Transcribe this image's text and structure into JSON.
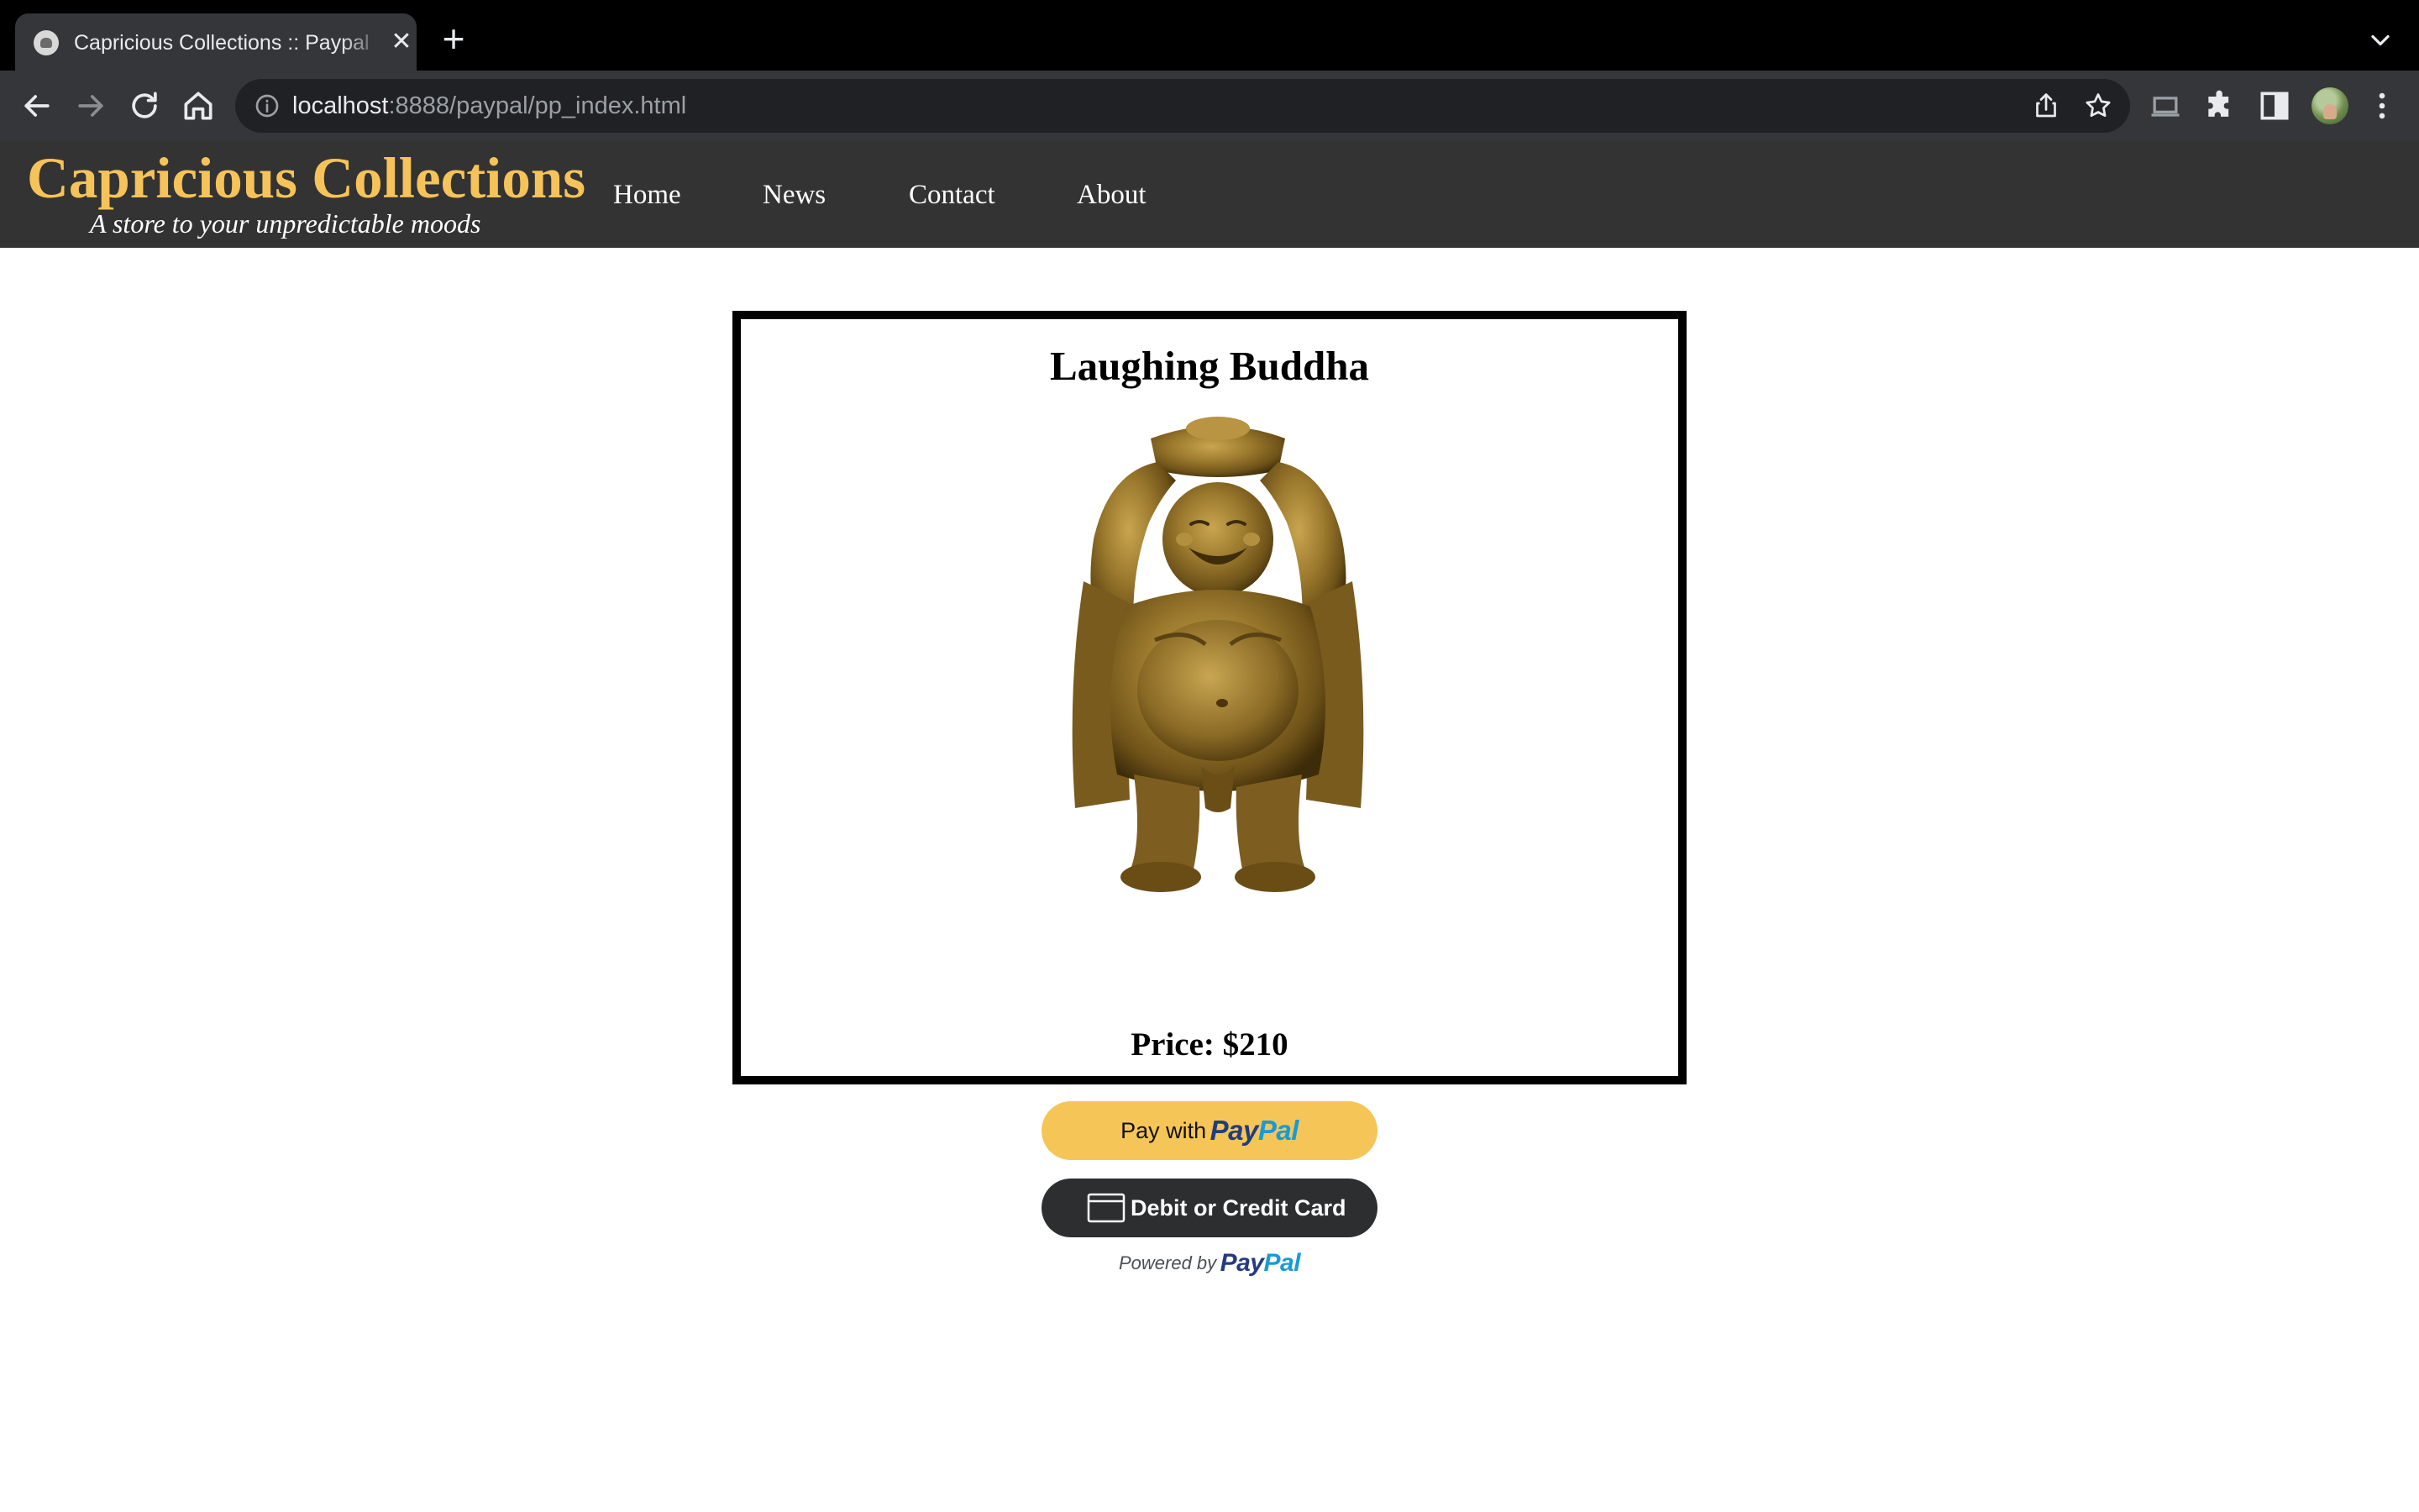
{
  "browser": {
    "tab_title": "Capricious Collections :: Paypal",
    "url_host": "localhost",
    "url_rest": ":8888/paypal/pp_index.html"
  },
  "site": {
    "name": "Capricious Collections",
    "tagline": "A store to your unpredictable moods",
    "nav": [
      "Home",
      "News",
      "Contact",
      "About"
    ]
  },
  "product": {
    "title": "Laughing Buddha",
    "price": "Price: $210",
    "image_alt": "gold-laughing-buddha-statue"
  },
  "paypal": {
    "pay_with_prefix": "Pay with",
    "logo_pay": "Pay",
    "logo_pal": "Pal",
    "card_button": "Debit or Credit Card",
    "powered_by": "Powered by",
    "colors": {
      "gold_button": "#f6c557",
      "black_button": "#2c2e2f",
      "logo_dark_blue": "#253b80",
      "logo_light_blue": "#179bd7"
    }
  },
  "colors": {
    "header_bg": "#333333",
    "site_name": "#f5c35a"
  }
}
